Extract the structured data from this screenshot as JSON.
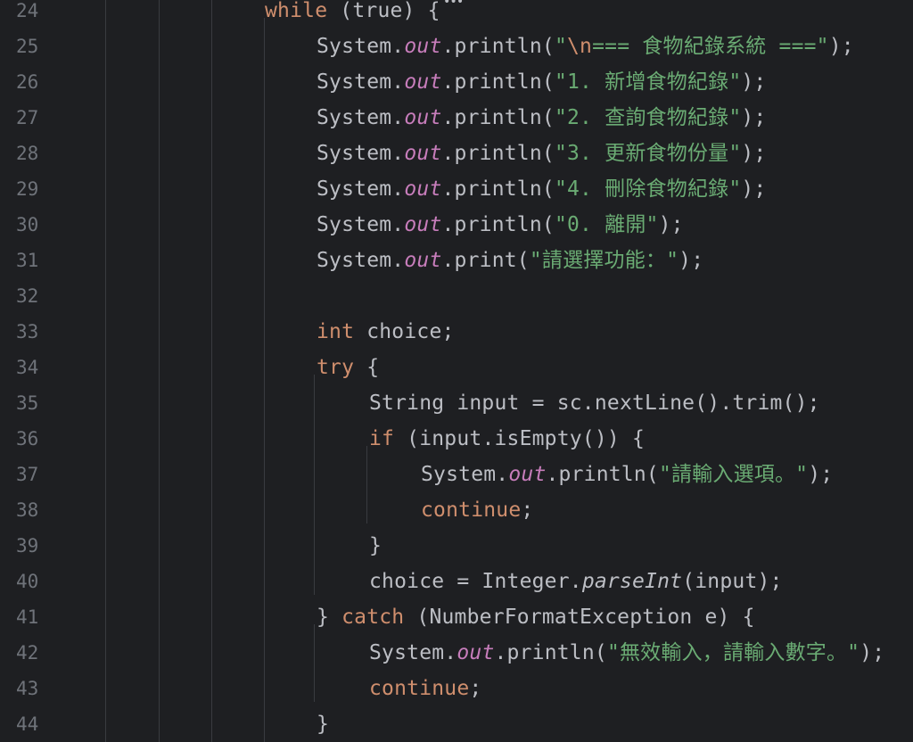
{
  "editor": {
    "lines": [
      {
        "num": "24",
        "tokens": [
          {
            "t": "kw",
            "v": "while"
          },
          {
            "t": "plain",
            "v": " (true) {"
          }
        ]
      },
      {
        "num": "25",
        "tokens": [
          {
            "t": "plain",
            "v": "System."
          },
          {
            "t": "field",
            "v": "out"
          },
          {
            "t": "plain",
            "v": ".println("
          },
          {
            "t": "str",
            "v": "\""
          },
          {
            "t": "escape",
            "v": "\\n"
          },
          {
            "t": "str",
            "v": "=== 食物紀錄系統 ===\""
          },
          {
            "t": "plain",
            "v": ");"
          }
        ]
      },
      {
        "num": "26",
        "tokens": [
          {
            "t": "plain",
            "v": "System."
          },
          {
            "t": "field",
            "v": "out"
          },
          {
            "t": "plain",
            "v": ".println("
          },
          {
            "t": "str",
            "v": "\"1. 新增食物紀錄\""
          },
          {
            "t": "plain",
            "v": ");"
          }
        ]
      },
      {
        "num": "27",
        "tokens": [
          {
            "t": "plain",
            "v": "System."
          },
          {
            "t": "field",
            "v": "out"
          },
          {
            "t": "plain",
            "v": ".println("
          },
          {
            "t": "str",
            "v": "\"2. 查詢食物紀錄\""
          },
          {
            "t": "plain",
            "v": ");"
          }
        ]
      },
      {
        "num": "28",
        "tokens": [
          {
            "t": "plain",
            "v": "System."
          },
          {
            "t": "field",
            "v": "out"
          },
          {
            "t": "plain",
            "v": ".println("
          },
          {
            "t": "str",
            "v": "\"3. 更新食物份量\""
          },
          {
            "t": "plain",
            "v": ");"
          }
        ]
      },
      {
        "num": "29",
        "tokens": [
          {
            "t": "plain",
            "v": "System."
          },
          {
            "t": "field",
            "v": "out"
          },
          {
            "t": "plain",
            "v": ".println("
          },
          {
            "t": "str",
            "v": "\"4. 刪除食物紀錄\""
          },
          {
            "t": "plain",
            "v": ");"
          }
        ]
      },
      {
        "num": "30",
        "tokens": [
          {
            "t": "plain",
            "v": "System."
          },
          {
            "t": "field",
            "v": "out"
          },
          {
            "t": "plain",
            "v": ".println("
          },
          {
            "t": "str",
            "v": "\"0. 離開\""
          },
          {
            "t": "plain",
            "v": ");"
          }
        ]
      },
      {
        "num": "31",
        "tokens": [
          {
            "t": "plain",
            "v": "System."
          },
          {
            "t": "field",
            "v": "out"
          },
          {
            "t": "plain",
            "v": ".print("
          },
          {
            "t": "str",
            "v": "\"請選擇功能：\""
          },
          {
            "t": "plain",
            "v": ");"
          }
        ]
      },
      {
        "num": "32",
        "tokens": []
      },
      {
        "num": "33",
        "tokens": [
          {
            "t": "kw",
            "v": "int"
          },
          {
            "t": "plain",
            "v": " choice;"
          }
        ]
      },
      {
        "num": "34",
        "tokens": [
          {
            "t": "kw",
            "v": "try"
          },
          {
            "t": "plain",
            "v": " {"
          }
        ]
      },
      {
        "num": "35",
        "tokens": [
          {
            "t": "plain",
            "v": "String input = sc.nextLine().trim();"
          }
        ]
      },
      {
        "num": "36",
        "tokens": [
          {
            "t": "kw",
            "v": "if"
          },
          {
            "t": "plain",
            "v": " (input.isEmpty()) {"
          }
        ]
      },
      {
        "num": "37",
        "tokens": [
          {
            "t": "plain",
            "v": "System."
          },
          {
            "t": "field",
            "v": "out"
          },
          {
            "t": "plain",
            "v": ".println("
          },
          {
            "t": "str",
            "v": "\"請輸入選項。\""
          },
          {
            "t": "plain",
            "v": ");"
          }
        ]
      },
      {
        "num": "38",
        "tokens": [
          {
            "t": "kw",
            "v": "continue"
          },
          {
            "t": "plain",
            "v": ";"
          }
        ]
      },
      {
        "num": "39",
        "tokens": [
          {
            "t": "plain",
            "v": "}"
          }
        ]
      },
      {
        "num": "40",
        "tokens": [
          {
            "t": "plain",
            "v": "choice = Integer."
          },
          {
            "t": "static",
            "v": "parseInt"
          },
          {
            "t": "plain",
            "v": "(input);"
          }
        ]
      },
      {
        "num": "41",
        "tokens": [
          {
            "t": "plain",
            "v": "} "
          },
          {
            "t": "kw",
            "v": "catch"
          },
          {
            "t": "plain",
            "v": " (NumberFormatException e) {"
          }
        ]
      },
      {
        "num": "42",
        "tokens": [
          {
            "t": "plain",
            "v": "System."
          },
          {
            "t": "field",
            "v": "out"
          },
          {
            "t": "plain",
            "v": ".println("
          },
          {
            "t": "str",
            "v": "\"無效輸入，請輸入數字。\""
          },
          {
            "t": "plain",
            "v": ");"
          }
        ]
      },
      {
        "num": "43",
        "tokens": [
          {
            "t": "kw",
            "v": "continue"
          },
          {
            "t": "plain",
            "v": ";"
          }
        ]
      },
      {
        "num": "44",
        "tokens": [
          {
            "t": "plain",
            "v": "}"
          }
        ]
      }
    ],
    "fold_marker": "•••",
    "colors": {
      "background": "#1e1f22",
      "line_number": "#6f737a",
      "plain": "#bcbec4",
      "keyword": "#cf8e6d",
      "string": "#6aab73",
      "field": "#c77dbb",
      "indent_guide": "#393b40"
    }
  }
}
